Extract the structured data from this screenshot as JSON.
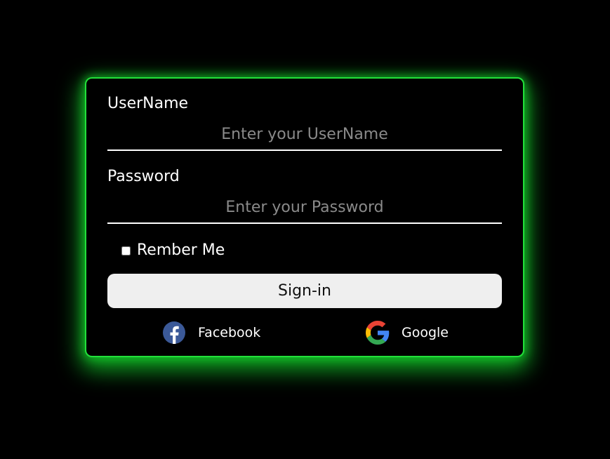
{
  "form": {
    "username": {
      "label": "UserName",
      "placeholder": "Enter your UserName",
      "value": ""
    },
    "password": {
      "label": "Password",
      "placeholder": "Enter your Password",
      "value": ""
    },
    "remember": {
      "label": "Rember Me",
      "checked": false
    },
    "signin_label": "Sign-in"
  },
  "social": [
    {
      "label": "Facebook",
      "icon": "facebook-icon",
      "color": "#3b5998"
    },
    {
      "label": "Google",
      "icon": "google-icon"
    }
  ],
  "colors": {
    "background": "#000000",
    "card_border": "#22e03a",
    "glow": "#14dc2d",
    "button_bg": "#efefef"
  }
}
